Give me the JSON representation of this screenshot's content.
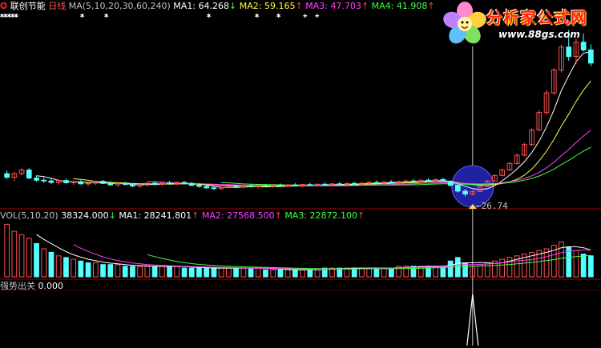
{
  "header": {
    "icon": "stock-icon",
    "stock_name": "联创节能",
    "period": "日线",
    "ma_label": "MA(5,10,20,30,60,240)",
    "ma1_label": "MA1:",
    "ma1_value": "64.268",
    "ma1_dir": "↓",
    "ma2_label": "MA2:",
    "ma2_value": "59.165",
    "ma2_dir": "↑",
    "ma3_label": "MA3:",
    "ma3_value": "47.703",
    "ma3_dir": "↑",
    "ma4_label": "MA4:",
    "ma4_value": "41.908",
    "ma4_dir": "↑"
  },
  "logo": {
    "text": "分析家公式网",
    "url": "www.88gs.com"
  },
  "volume_header": {
    "label": "VOL(5,10,20)",
    "vol_value": "38324.000",
    "vol_dir": "↓",
    "ma1_label": "MA1:",
    "ma1_value": "28241.801",
    "ma1_dir": "↑",
    "ma2_label": "MA2:",
    "ma2_value": "27568.500",
    "ma2_dir": "↑",
    "ma3_label": "MA3:",
    "ma3_value": "22872.100",
    "ma3_dir": "↑"
  },
  "indicator_header": {
    "label": "强势出关",
    "value": "0.000"
  },
  "annotations": {
    "low_price": "26.74"
  },
  "colors": {
    "background": "#000000",
    "up": "#ff5050",
    "down": "#54ffff",
    "ma1": "#ffffff",
    "ma2": "#ffff40",
    "ma3": "#ff40ff",
    "ma4": "#40ff40",
    "grid": "#a00000",
    "circle": "#2020a0"
  },
  "chart_data": [
    {
      "type": "candlestick",
      "title": "联创节能 日线",
      "ma_periods": [
        5,
        10,
        20,
        30,
        60,
        240
      ],
      "ohlc": [
        [
          33.0,
          33.8,
          31.5,
          32.0
        ],
        [
          32.0,
          33.5,
          31.0,
          33.0
        ],
        [
          33.0,
          34.5,
          32.5,
          34.0
        ],
        [
          34.0,
          34.5,
          31.5,
          31.8
        ],
        [
          31.8,
          32.5,
          30.8,
          31.2
        ],
        [
          31.2,
          32.0,
          30.5,
          31.0
        ],
        [
          31.0,
          31.6,
          30.2,
          30.6
        ],
        [
          30.6,
          31.4,
          30.0,
          31.1
        ],
        [
          31.1,
          31.6,
          30.3,
          30.5
        ],
        [
          30.5,
          31.1,
          29.9,
          30.8
        ],
        [
          30.8,
          31.2,
          30.0,
          30.2
        ],
        [
          30.2,
          30.8,
          29.6,
          30.4
        ],
        [
          30.4,
          31.1,
          29.9,
          30.9
        ],
        [
          30.9,
          31.3,
          30.1,
          30.3
        ],
        [
          30.3,
          30.9,
          29.7,
          29.9
        ],
        [
          29.9,
          30.6,
          29.4,
          30.3
        ],
        [
          30.3,
          30.8,
          29.8,
          30.0
        ],
        [
          30.0,
          30.5,
          29.3,
          29.6
        ],
        [
          29.6,
          30.2,
          29.1,
          29.9
        ],
        [
          29.9,
          30.6,
          29.6,
          30.4
        ],
        [
          30.4,
          30.9,
          29.9,
          30.1
        ],
        [
          30.1,
          30.7,
          29.6,
          30.5
        ],
        [
          30.5,
          31.0,
          30.0,
          30.2
        ],
        [
          30.2,
          30.8,
          29.8,
          30.6
        ],
        [
          30.6,
          31.0,
          30.1,
          30.3
        ],
        [
          30.3,
          30.7,
          29.5,
          29.8
        ],
        [
          29.8,
          30.3,
          29.2,
          29.5
        ],
        [
          29.5,
          30.0,
          28.8,
          29.1
        ],
        [
          29.1,
          29.6,
          28.5,
          28.9
        ],
        [
          28.9,
          29.5,
          28.5,
          29.2
        ],
        [
          29.2,
          29.8,
          28.9,
          29.5
        ],
        [
          29.5,
          30.0,
          29.1,
          29.3
        ],
        [
          29.3,
          29.9,
          28.9,
          29.6
        ],
        [
          29.6,
          30.1,
          29.2,
          29.4
        ],
        [
          29.4,
          29.9,
          29.0,
          29.7
        ],
        [
          29.7,
          30.2,
          29.3,
          29.5
        ],
        [
          29.5,
          30.0,
          29.1,
          29.8
        ],
        [
          29.8,
          30.3,
          29.4,
          29.6
        ],
        [
          29.6,
          30.1,
          29.2,
          29.9
        ],
        [
          29.9,
          30.4,
          29.5,
          29.7
        ],
        [
          29.7,
          30.2,
          29.3,
          30.0
        ],
        [
          30.0,
          30.5,
          29.6,
          29.8
        ],
        [
          29.8,
          30.3,
          29.4,
          30.1
        ],
        [
          30.1,
          30.6,
          29.7,
          29.9
        ],
        [
          29.9,
          30.4,
          29.5,
          30.2
        ],
        [
          30.2,
          30.7,
          29.8,
          30.0
        ],
        [
          30.0,
          30.5,
          29.6,
          30.3
        ],
        [
          30.3,
          30.8,
          29.9,
          30.1
        ],
        [
          30.1,
          30.6,
          29.7,
          30.4
        ],
        [
          30.4,
          30.9,
          30.0,
          30.6
        ],
        [
          30.6,
          31.1,
          30.2,
          30.4
        ],
        [
          30.4,
          30.9,
          30.0,
          30.7
        ],
        [
          30.7,
          31.2,
          30.3,
          30.5
        ],
        [
          30.5,
          31.0,
          30.1,
          30.8
        ],
        [
          30.8,
          31.3,
          30.4,
          31.0
        ],
        [
          31.0,
          31.5,
          30.6,
          30.8
        ],
        [
          30.8,
          31.4,
          30.5,
          31.2
        ],
        [
          31.2,
          31.8,
          30.9,
          31.0
        ],
        [
          31.0,
          31.6,
          30.6,
          31.4
        ],
        [
          31.4,
          31.8,
          30.9,
          30.9
        ],
        [
          30.9,
          31.2,
          29.5,
          29.8
        ],
        [
          29.8,
          30.2,
          27.8,
          28.2
        ],
        [
          28.2,
          28.8,
          26.74,
          27.4
        ],
        [
          27.4,
          28.4,
          27.0,
          28.1
        ],
        [
          28.1,
          29.9,
          27.9,
          29.6
        ],
        [
          29.6,
          31.2,
          29.4,
          31.0
        ],
        [
          31.0,
          32.8,
          30.8,
          32.5
        ],
        [
          32.5,
          34.4,
          32.2,
          34.0
        ],
        [
          34.0,
          36.2,
          33.7,
          35.8
        ],
        [
          35.8,
          38.5,
          35.5,
          38.1
        ],
        [
          38.1,
          41.5,
          37.8,
          41.0
        ],
        [
          41.0,
          45.5,
          40.6,
          45.0
        ],
        [
          45.0,
          50.5,
          44.6,
          49.8
        ],
        [
          49.8,
          56.0,
          49.2,
          55.2
        ],
        [
          55.2,
          62.0,
          54.6,
          61.5
        ],
        [
          61.5,
          68.5,
          60.8,
          67.8
        ],
        [
          67.8,
          72.5,
          64.0,
          65.2
        ],
        [
          65.2,
          70.0,
          63.0,
          69.1
        ],
        [
          69.1,
          71.5,
          66.5,
          67.0
        ],
        [
          67.0,
          68.5,
          62.5,
          63.4
        ]
      ],
      "volume": [
        [
          30,
          1
        ],
        [
          26,
          1
        ],
        [
          24,
          1
        ],
        [
          22,
          1
        ],
        [
          19,
          0
        ],
        [
          16,
          1
        ],
        [
          14,
          0
        ],
        [
          12,
          1
        ],
        [
          11,
          0
        ],
        [
          10,
          1
        ],
        [
          9,
          0
        ],
        [
          8,
          0
        ],
        [
          8,
          1
        ],
        [
          7,
          0
        ],
        [
          7,
          0
        ],
        [
          7,
          1
        ],
        [
          6,
          0
        ],
        [
          6,
          0
        ],
        [
          6,
          1
        ],
        [
          6,
          1
        ],
        [
          6,
          0
        ],
        [
          6,
          1
        ],
        [
          6,
          0
        ],
        [
          6,
          1
        ],
        [
          5,
          0
        ],
        [
          5,
          0
        ],
        [
          5,
          0
        ],
        [
          5,
          0
        ],
        [
          5,
          0
        ],
        [
          5,
          1
        ],
        [
          5,
          1
        ],
        [
          5,
          0
        ],
        [
          5,
          1
        ],
        [
          5,
          0
        ],
        [
          5,
          1
        ],
        [
          4,
          0
        ],
        [
          4,
          1
        ],
        [
          4,
          0
        ],
        [
          4,
          1
        ],
        [
          4,
          0
        ],
        [
          4,
          1
        ],
        [
          4,
          0
        ],
        [
          4,
          1
        ],
        [
          5,
          0
        ],
        [
          5,
          1
        ],
        [
          5,
          0
        ],
        [
          5,
          1
        ],
        [
          5,
          0
        ],
        [
          5,
          1
        ],
        [
          5,
          1
        ],
        [
          5,
          0
        ],
        [
          5,
          1
        ],
        [
          5,
          0
        ],
        [
          6,
          1
        ],
        [
          6,
          1
        ],
        [
          6,
          0
        ],
        [
          6,
          1
        ],
        [
          6,
          0
        ],
        [
          6,
          1
        ],
        [
          6,
          0
        ],
        [
          9,
          0
        ],
        [
          11,
          0
        ],
        [
          8,
          0
        ],
        [
          6,
          1
        ],
        [
          7,
          1
        ],
        [
          8,
          1
        ],
        [
          9,
          1
        ],
        [
          10,
          1
        ],
        [
          11,
          1
        ],
        [
          12,
          1
        ],
        [
          13,
          1
        ],
        [
          14,
          1
        ],
        [
          15,
          1
        ],
        [
          16,
          1
        ],
        [
          18,
          1
        ],
        [
          20,
          1
        ],
        [
          17,
          0
        ],
        [
          15,
          1
        ],
        [
          13,
          0
        ],
        [
          12,
          0
        ]
      ],
      "signal_index": 63
    }
  ]
}
